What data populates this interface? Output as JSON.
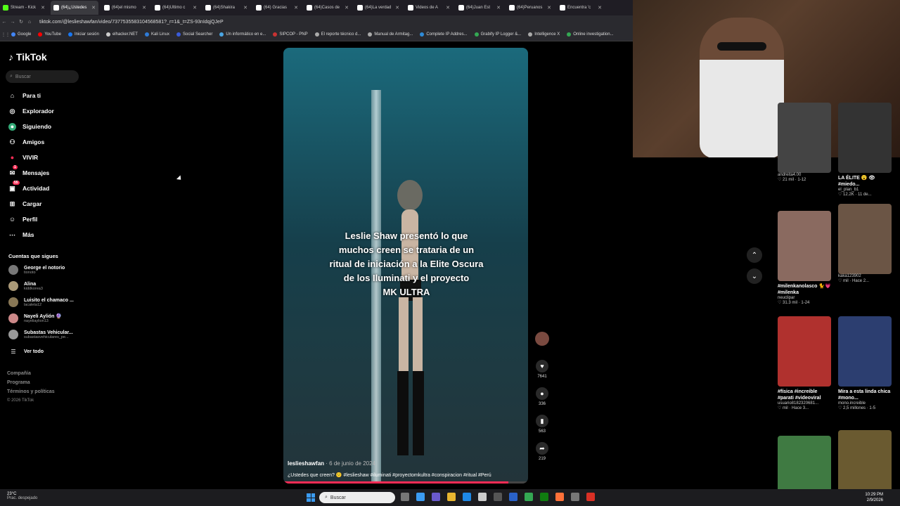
{
  "tabs": [
    {
      "label": "Stream - Kick",
      "color": "#53fc18"
    },
    {
      "label": "(64)¿Ustedes",
      "color": "#ffffff",
      "active": true
    },
    {
      "label": "(64)el mismo",
      "color": "#ffffff"
    },
    {
      "label": "(64)Ultimo c",
      "color": "#ffffff"
    },
    {
      "label": "(64)Shakira",
      "color": "#ffffff"
    },
    {
      "label": "(64) Gracias",
      "color": "#ffffff"
    },
    {
      "label": "(64)Casos de",
      "color": "#ffffff"
    },
    {
      "label": "(64)La verdad",
      "color": "#ffffff"
    },
    {
      "label": "Videos de A",
      "color": "#ffffff"
    },
    {
      "label": "(64)Juan Est",
      "color": "#ffffff"
    },
    {
      "label": "(64)Peruanos",
      "color": "#ffffff"
    },
    {
      "label": "Encuentra 'c",
      "color": "#ffffff"
    }
  ],
  "address": {
    "url": "tiktok.com/@leslieshawfan/video/7377535583104568581?_r=1&_t=ZS-93nIdqjQJeP"
  },
  "bookmarks": [
    {
      "label": "Google",
      "color": "#4285f4"
    },
    {
      "label": "YouTube",
      "color": "#ff0000"
    },
    {
      "label": "Iniciar sesión",
      "color": "#1877f2"
    },
    {
      "label": "elhacker.NET",
      "color": "#cccccc"
    },
    {
      "label": "Kali Linux",
      "color": "#2f7bd6"
    },
    {
      "label": "Social Searcher",
      "color": "#3a5bd9"
    },
    {
      "label": "Un informático en e...",
      "color": "#4aa5e3"
    },
    {
      "label": "SIPCOP - PNP",
      "color": "#c83232"
    },
    {
      "label": "El reporte técnico d...",
      "color": "#aaaaaa"
    },
    {
      "label": "Manual de Armitag...",
      "color": "#aaaaaa"
    },
    {
      "label": "Complete IP Addres...",
      "color": "#2e8bd8"
    },
    {
      "label": "Grabify IP Logger &...",
      "color": "#34a853"
    },
    {
      "label": "Intelligence X",
      "color": "#aaaaaa"
    },
    {
      "label": "Online investigation...",
      "color": "#34a853"
    }
  ],
  "sidebar": {
    "logo": "TikTok",
    "search_placeholder": "Buscar",
    "items": [
      {
        "label": "Para ti",
        "icon": "home-icon",
        "glyph": "⌂"
      },
      {
        "label": "Explorador",
        "icon": "compass-icon",
        "glyph": "◎"
      },
      {
        "label": "Siguiendo",
        "icon": "following-icon",
        "glyph": "●"
      },
      {
        "label": "Amigos",
        "icon": "friends-icon",
        "glyph": "⚇"
      },
      {
        "label": "VIVIR",
        "icon": "live-icon",
        "glyph": "●"
      },
      {
        "label": "Mensajes",
        "icon": "messages-icon",
        "glyph": "✉",
        "badge": "1"
      },
      {
        "label": "Actividad",
        "icon": "activity-icon",
        "glyph": "▣",
        "badge": "55"
      },
      {
        "label": "Cargar",
        "icon": "upload-icon",
        "glyph": "⊞"
      },
      {
        "label": "Perfil",
        "icon": "profile-icon",
        "glyph": "☺"
      },
      {
        "label": "Más",
        "icon": "more-icon",
        "glyph": "⋯"
      }
    ],
    "following_title": "Cuentas que sigues",
    "accounts": [
      {
        "name": "George el notorio",
        "handle": "tionoto",
        "color": "#777"
      },
      {
        "name": "Alina",
        "handle": "kiddkorea3",
        "color": "#a97"
      },
      {
        "name": "Luisito el chamaco ...",
        "handle": "lacaleta12",
        "color": "#875"
      },
      {
        "name": "Nayeli Aylión 🔮",
        "handle": "nayeliaylion13",
        "color": "#c88"
      },
      {
        "name": "Subastas Vehicular...",
        "handle": "subastasvehiculares_pe...",
        "color": "#999"
      }
    ],
    "see_all": "Ver todo",
    "footer": [
      "Compañía",
      "Programa",
      "Términos y políticas",
      "© 2026 TikTok"
    ]
  },
  "video": {
    "overlay_lines": [
      "Leslie Shaw presentó lo que",
      "muchos creen se trataria de un",
      "ritual de iniciación a la Elite Oscura",
      "de los Iluminati y el proyecto",
      "MK ULTRA"
    ],
    "author": "leslieshawfan",
    "date": "· 6 de junio de 2024",
    "caption": "¿Ustedes que creen? 😕 #leslieshaw #iluminati #proyectomkultra #conspiracion #ritual #Perú",
    "progress": 0.92
  },
  "actions": [
    {
      "name": "like",
      "icon": "heart-icon",
      "glyph": "♥",
      "count": "7641"
    },
    {
      "name": "comment",
      "icon": "comment-icon",
      "glyph": "●",
      "count": "336"
    },
    {
      "name": "save",
      "icon": "bookmark-icon",
      "glyph": "▮",
      "count": "563"
    },
    {
      "name": "share",
      "icon": "share-icon",
      "glyph": "➦",
      "count": "219"
    }
  ],
  "grid": [
    {
      "title": "",
      "user": "andreita4.00",
      "stats": "♡ 21 mil · 1-12",
      "color": "#444"
    },
    {
      "title": "LA ÉLITE 😮 👁 #miedo...",
      "user": "el_plan_b1",
      "stats": "♡ 12.2K · 11 de...",
      "color": "#333"
    },
    {
      "title": "#milenkanolasco 🐈💗 #milenka",
      "user": "neuclipar",
      "stats": "♡ 31.3 mil · 1-24",
      "color": "#8a6a60"
    },
    {
      "title": "",
      "user": "kaka123902",
      "stats": "♡ mil · Hace 2...",
      "color": "#6b5545"
    },
    {
      "title": "#física #increible #parati #videoviral",
      "user": "usuario8182320681...",
      "stats": "♡ mil · Hace 3...",
      "color": "#b0312e"
    },
    {
      "title": "Mira a esta linda chica #mono...",
      "user": "mono.increible",
      "stats": "♡ 2,5 millones · 1-5",
      "color": "#2c3e70"
    },
    {
      "title": "",
      "user": "",
      "stats": "",
      "color": "#3f7a42"
    },
    {
      "title": "",
      "user": "",
      "stats": "",
      "color": "#6a5a30"
    }
  ],
  "taskbar": {
    "weather_temp": "23°C",
    "weather_desc": "Prac. despejado",
    "search": "Buscar",
    "time": "10:29 PM",
    "date": "2/9/2026"
  }
}
